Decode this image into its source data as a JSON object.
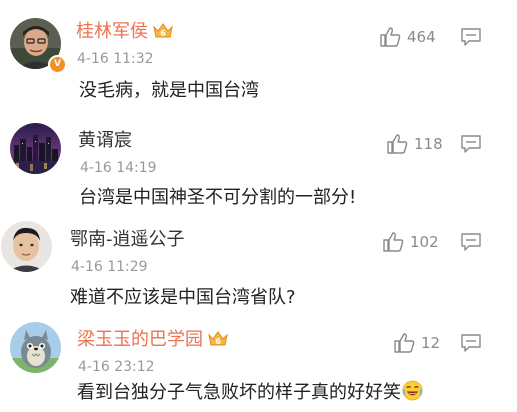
{
  "comments": [
    {
      "username": "桂林军侯",
      "time": "4-16 11:32",
      "text": "没毛病，就是中国台湾",
      "likes": "464"
    },
    {
      "username": "黄谞宸",
      "time": "4-16 14:19",
      "text": "台湾是中国神圣不可分割的一部分!",
      "likes": "118"
    },
    {
      "username": "鄂南-逍遥公子",
      "time": "4-16 11:29",
      "text": "难道不应该是中国台湾省队?",
      "likes": "102"
    },
    {
      "username": "梁玉玉的巴学园",
      "time": "4-16 23:12",
      "text": "看到台独分子气急败坏的样子真的好好笑",
      "likes": "12"
    }
  ],
  "icons": {
    "like": "thumbs-up-icon",
    "reply": "comment-icon",
    "member": "crown-icon",
    "verified": "v-badge-icon",
    "emoji": "laughing-emoji-icon"
  },
  "colors": {
    "vip_name": "#eb7350",
    "normal_name": "#333333",
    "meta": "#999999",
    "text": "#222222"
  }
}
